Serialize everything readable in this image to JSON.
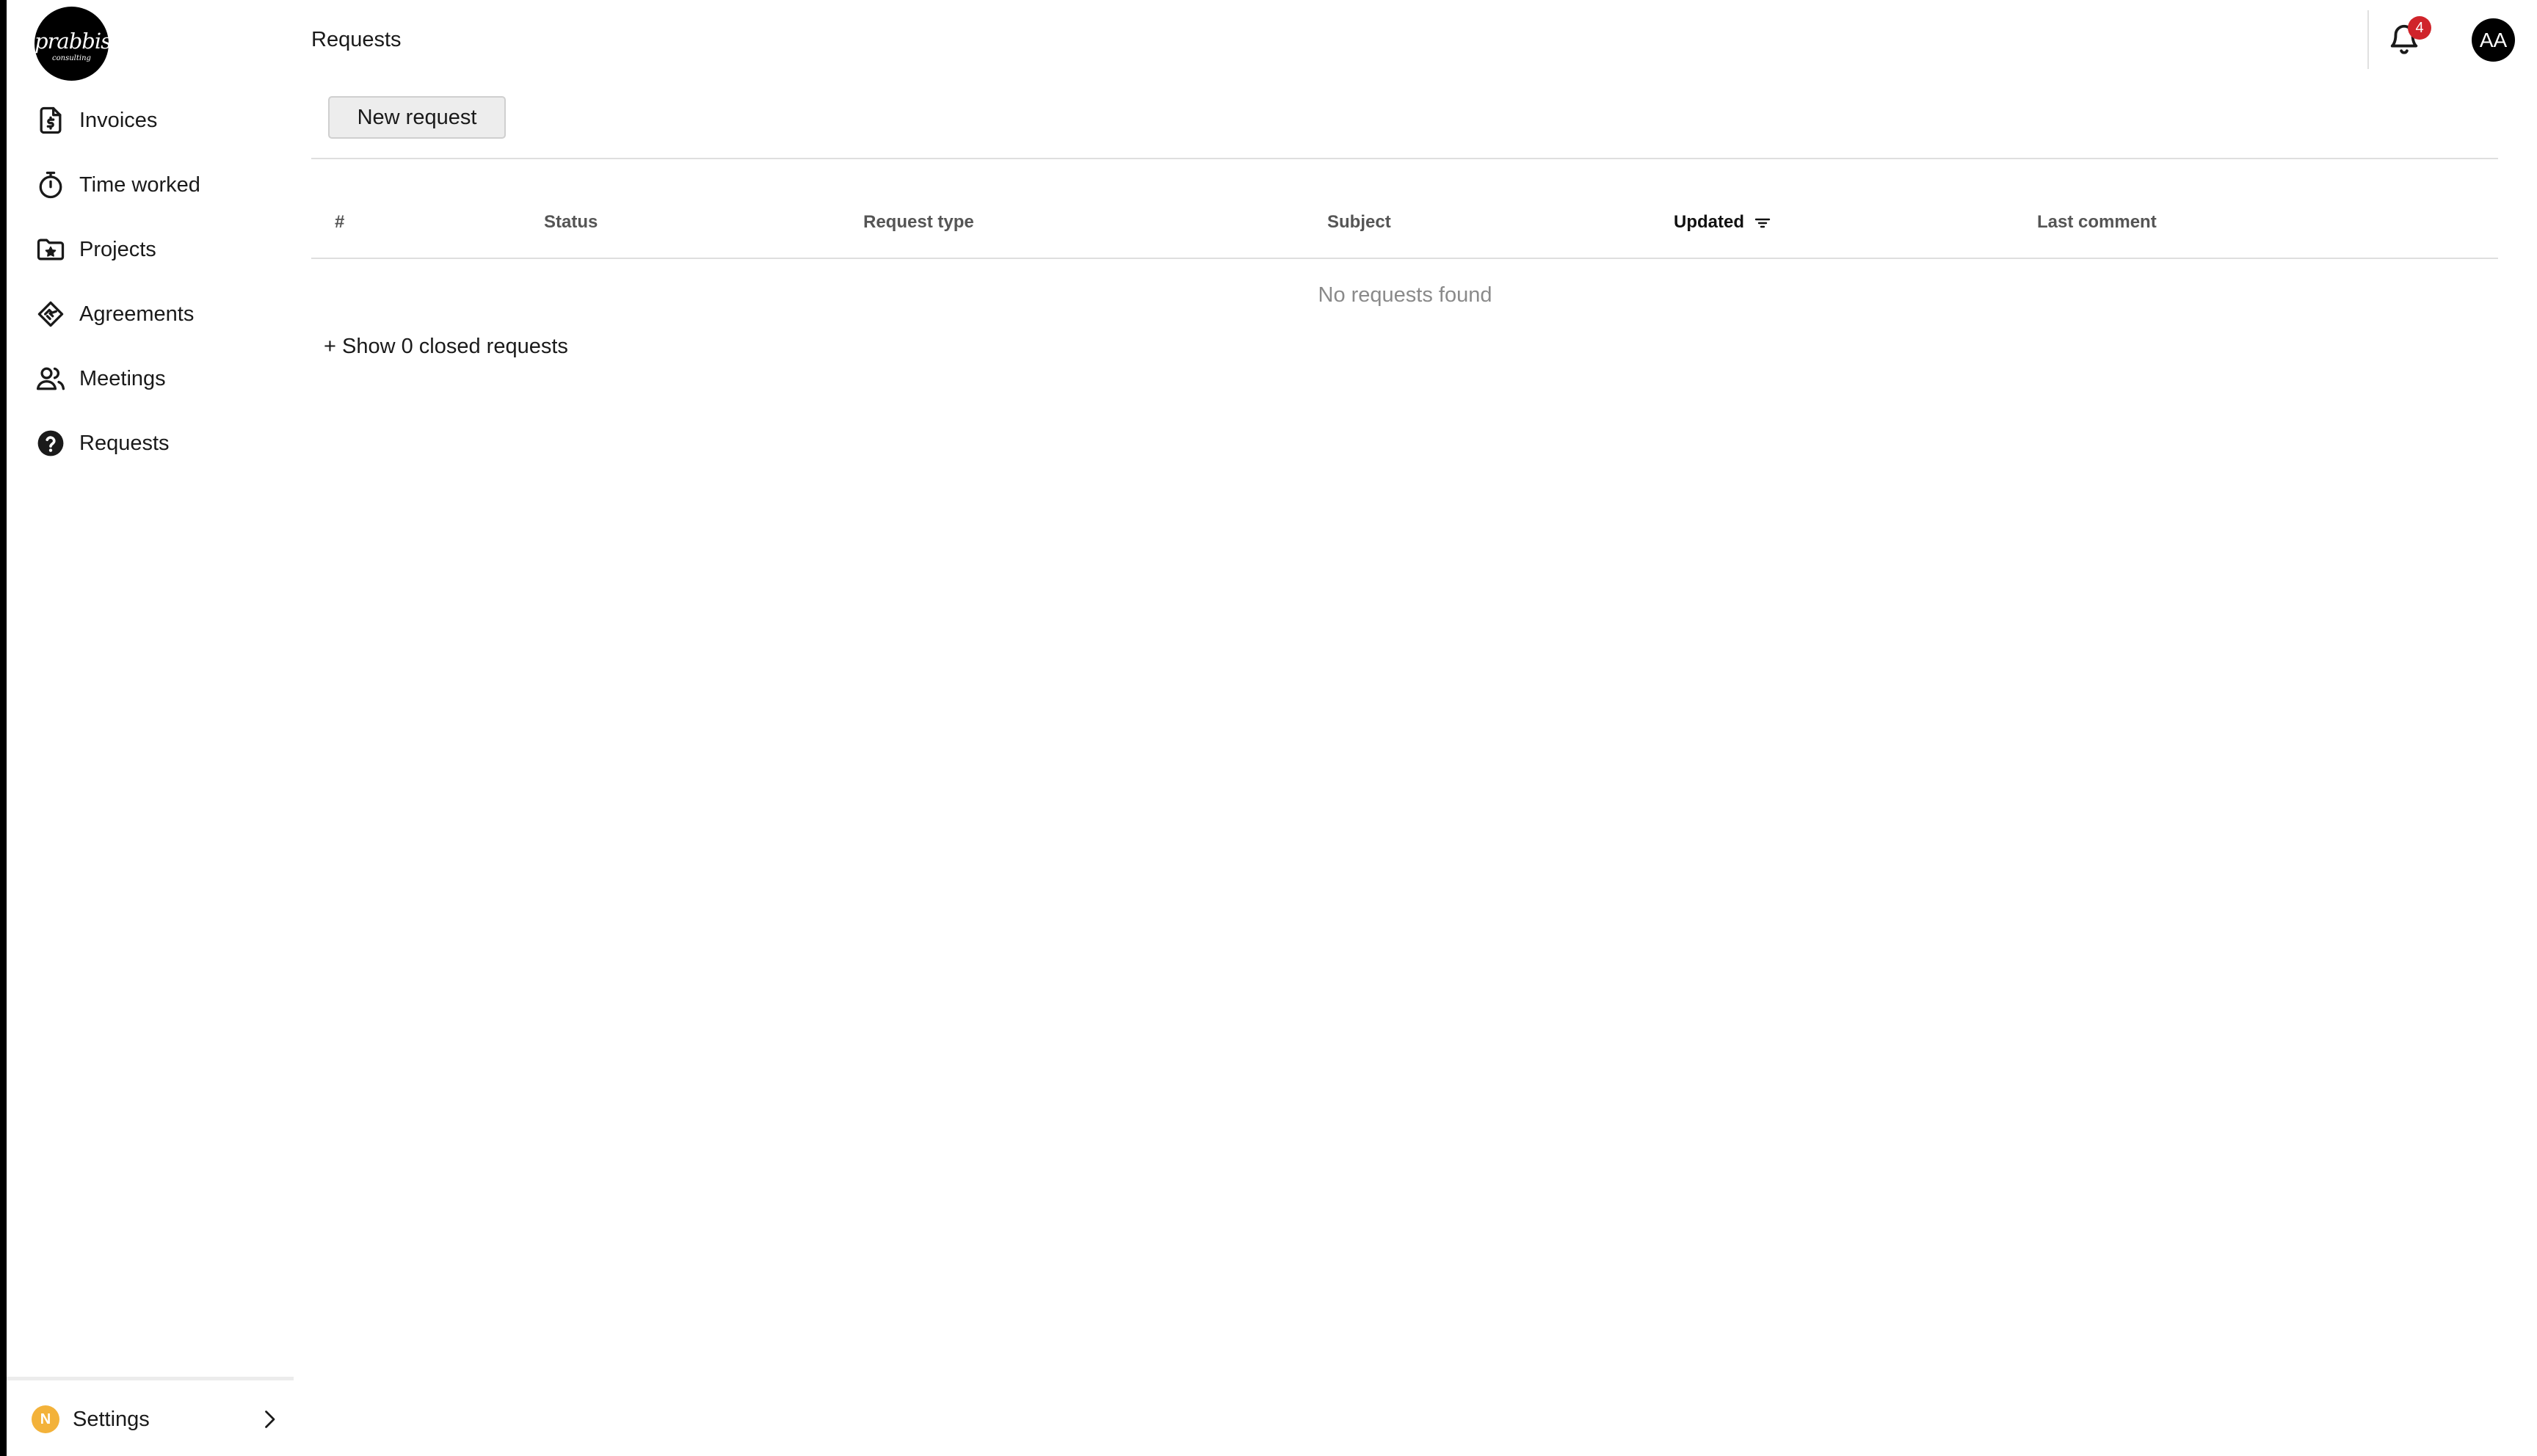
{
  "brand": {
    "logo_text": "prabbis",
    "logo_subtext": "consulting"
  },
  "sidebar": {
    "items": [
      {
        "label": "Invoices",
        "icon": "invoice-icon"
      },
      {
        "label": "Time worked",
        "icon": "stopwatch-icon"
      },
      {
        "label": "Projects",
        "icon": "folder-star-icon"
      },
      {
        "label": "Agreements",
        "icon": "handshake-icon"
      },
      {
        "label": "Meetings",
        "icon": "users-icon"
      },
      {
        "label": "Requests",
        "icon": "help-circle-icon"
      }
    ],
    "settings": {
      "label": "Settings",
      "badge": "N",
      "badge_color": "#f3b23a"
    }
  },
  "header": {
    "title": "Requests",
    "notifications": {
      "count": "4",
      "badge_color": "#d0242b"
    },
    "avatar_initials": "AA"
  },
  "toolbar": {
    "new_request_label": "New request"
  },
  "table": {
    "columns": [
      "#",
      "Status",
      "Request type",
      "Subject",
      "Updated",
      "Last comment"
    ],
    "sorted_column": "Updated",
    "empty_text": "No requests found"
  },
  "footer_link": {
    "label": "+ Show 0 closed requests"
  }
}
